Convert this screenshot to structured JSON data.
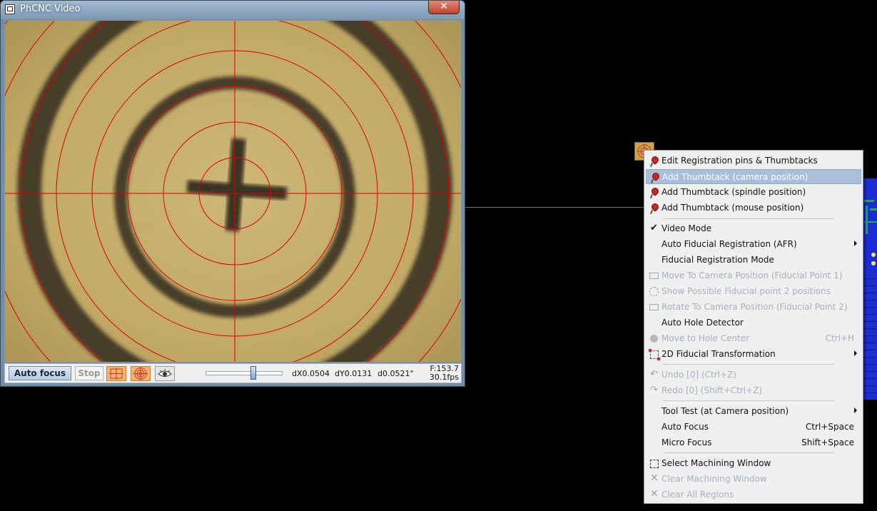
{
  "video_window": {
    "title": "PhCNC Video",
    "close_label": "✕",
    "toolbar": {
      "auto_focus_label": "Auto focus",
      "stop_label": "Stop",
      "slider_value_fraction": 0.62,
      "dx": "dX0.0504",
      "dy": "dY0.0131",
      "d": "d0.0521\"",
      "focus": "F:153.7",
      "fps": "30.1fps"
    },
    "overlay_color": "#e00000"
  },
  "context_menu": {
    "items": [
      {
        "label": "Edit Registration pins & Thumbtacks",
        "icon": "thumbtack-icon"
      },
      {
        "label": "Add Thumbtack (camera position)",
        "icon": "thumbtack-icon",
        "highlighted": true
      },
      {
        "label": "Add Thumbtack (spindle position)",
        "icon": "thumbtack-icon"
      },
      {
        "label": "Add Thumbtack (mouse position)",
        "icon": "thumbtack-icon"
      },
      {
        "label": "Video Mode",
        "icon": "checkmark-icon",
        "checked": true
      },
      {
        "label": "Auto Fiducial Registration (AFR)",
        "submenu": true
      },
      {
        "label": "Fiducial Registration Mode"
      },
      {
        "label": "Move To Camera Position (Fiducial Point 1)",
        "icon": "camera-move-icon",
        "disabled": true
      },
      {
        "label": "Show Possible Fiducial point 2 positions",
        "icon": "dashed-circle-icon",
        "disabled": true
      },
      {
        "label": "Rotate To Camera Position (Fiducial Point 2)",
        "icon": "camera-rotate-icon",
        "disabled": true
      },
      {
        "label": "Auto Hole Detector"
      },
      {
        "label": "Move to Hole Center",
        "icon": "hole-center-icon",
        "shortcut": "Ctrl+H",
        "disabled": true
      },
      {
        "label": "2D Fiducial Transformation",
        "icon": "transform-icon",
        "submenu": true
      },
      {
        "label": "Undo [0] (Ctrl+Z)",
        "icon": "undo-icon",
        "disabled": true
      },
      {
        "label": "Redo [0] (Shift+Ctrl+Z)",
        "icon": "redo-icon",
        "disabled": true
      },
      {
        "label": "Tool Test (at Camera position)",
        "submenu": true
      },
      {
        "label": "Auto Focus",
        "shortcut": "Ctrl+Space"
      },
      {
        "label": "Micro Focus",
        "shortcut": "Shift+Space"
      },
      {
        "label": "Select Machining Window",
        "icon": "selection-box-icon"
      },
      {
        "label": "Clear Machining Window",
        "icon": "clear-icon",
        "disabled": true
      },
      {
        "label": "Clear All Regions",
        "icon": "clear-icon",
        "disabled": true
      }
    ],
    "highlight_color": "#a9bfd9",
    "disabled_color": "#a7b0c0"
  }
}
